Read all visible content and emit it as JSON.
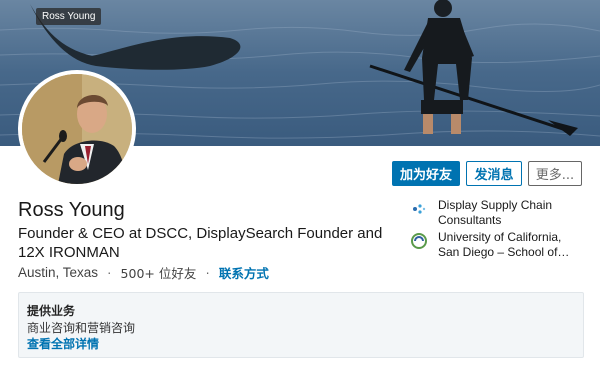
{
  "banner": {
    "tag": "Ross Young"
  },
  "profile": {
    "name": "Ross Young",
    "headline": "Founder & CEO at DSCC, DisplaySearch Founder and 12X IRONMAN",
    "location": "Austin, Texas",
    "separator": "·",
    "connections": "500+ 位好友",
    "contact_info": "联系方式"
  },
  "actions": {
    "connect": "加为好友",
    "message": "发消息",
    "more": "更多..."
  },
  "experience": [
    {
      "org": "Display Supply Chain Consultants",
      "icon": "dscc-logo-icon"
    },
    {
      "org": "University of California, San Diego – School of…",
      "icon": "ucsd-logo-icon"
    }
  ],
  "services": {
    "title": "提供业务",
    "description": "商业咨询和营销咨询",
    "see_all": "查看全部详情"
  },
  "colors": {
    "accent": "#0073b1",
    "services_bg": "#f3f6f8"
  }
}
